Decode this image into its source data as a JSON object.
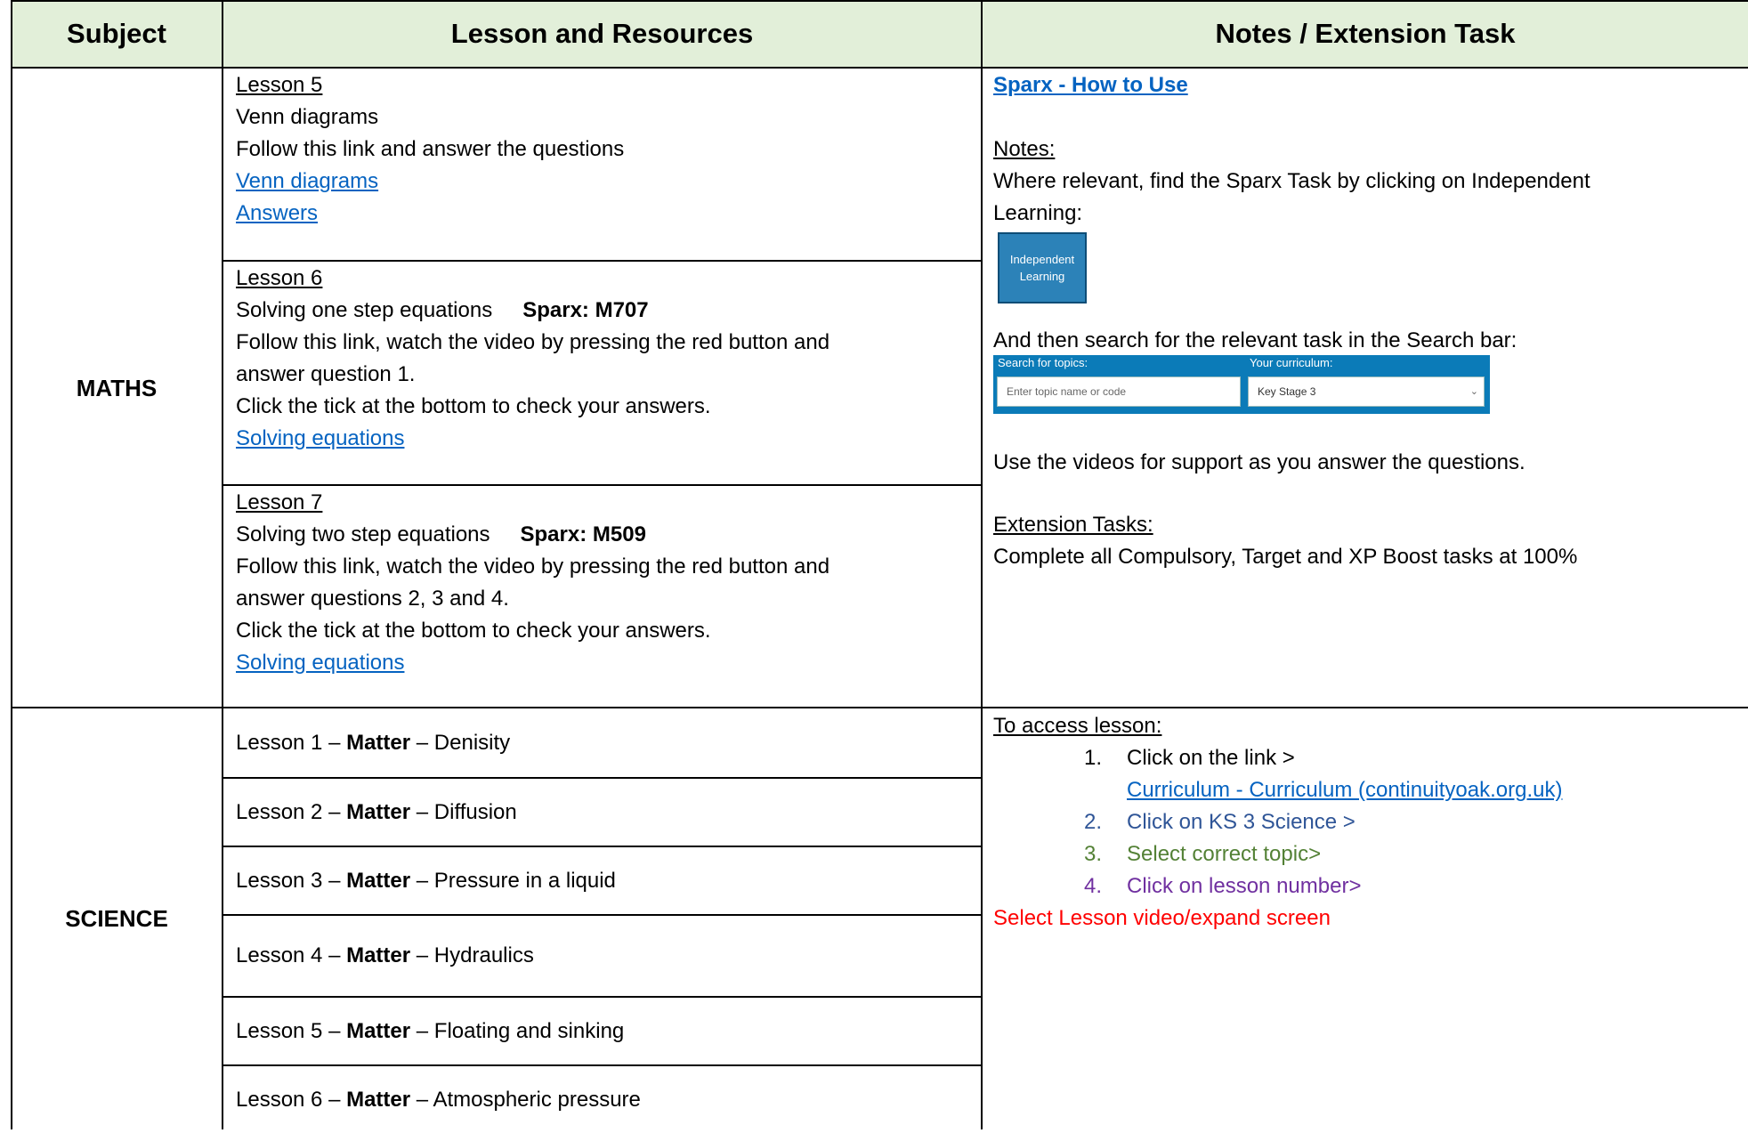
{
  "header": {
    "subject": "Subject",
    "lesson_resources": "Lesson and Resources",
    "notes": "Notes / Extension Task"
  },
  "maths": {
    "subject": "MATHS",
    "lesson5": {
      "title": "Lesson 5",
      "topic": "Venn diagrams",
      "instruction": "Follow this link and answer the questions",
      "link1": "Venn diagrams",
      "link2": "Answers"
    },
    "lesson6": {
      "title": "Lesson 6",
      "topic": "Solving one step equations",
      "sparx": "Sparx: M707",
      "line1": "Follow this link, watch the video by pressing the red button and",
      "line2": "answer question 1.",
      "line3": "Click the tick at the bottom to check your answers.",
      "link": "Solving equations"
    },
    "lesson7": {
      "title": "Lesson 7",
      "topic": "Solving two step equations",
      "sparx": "Sparx: M509",
      "line1": "Follow this link, watch the video by pressing the red button and",
      "line2": "answer questions 2, 3 and 4.",
      "line3": "Click the tick at the bottom to check your answers.",
      "link": "Solving equations"
    },
    "notes": {
      "sparx_link": "Sparx - How to Use",
      "notes_heading": "Notes:",
      "notes_line1": "Where relevant, find the Sparx Task by clicking on Independent",
      "notes_line2": "Learning:",
      "il_button_line1": "Independent",
      "il_button_line2": "Learning",
      "search_text": "And then search for the relevant task in the Search bar:",
      "search_topics_label": "Search for topics:",
      "search_placeholder": "Enter topic name or code",
      "curriculum_label": "Your curriculum:",
      "curriculum_value": "Key Stage 3",
      "videos_text": "Use the videos for support as you answer the questions.",
      "ext_heading": "Extension Tasks:",
      "ext_text": "Complete all Compulsory, Target and XP Boost tasks at 100%"
    }
  },
  "science": {
    "subject": "SCIENCE",
    "lessons": [
      {
        "prefix": "Lesson 1 – ",
        "bold": "Matter",
        "suffix": " – Denisity"
      },
      {
        "prefix": "Lesson 2 – ",
        "bold": "Matter",
        "suffix": " – Diffusion"
      },
      {
        "prefix": "Lesson 3 – ",
        "bold": "Matter",
        "suffix": " – Pressure in a liquid"
      },
      {
        "prefix": "Lesson 4 – ",
        "bold": "Matter",
        "suffix": " – Hydraulics"
      },
      {
        "prefix": "Lesson 5 – ",
        "bold": "Matter",
        "suffix": " – Floating and sinking"
      },
      {
        "prefix": "Lesson 6 – ",
        "bold": "Matter",
        "suffix": " – Atmospheric pressure"
      }
    ],
    "notes": {
      "heading": "To access lesson:",
      "steps": [
        {
          "num": "1.",
          "text": "Click on the link >"
        },
        {
          "num": "",
          "text": "Curriculum - Curriculum (continuityoak.org.uk)"
        },
        {
          "num": "2.",
          "text": "Click on KS 3 Science >"
        },
        {
          "num": "3.",
          "text": "Select correct topic>"
        },
        {
          "num": "4.",
          "text": "Click on lesson number>"
        }
      ],
      "final": "Select Lesson video/expand screen"
    }
  },
  "colors": {
    "header_bg": "#e2efd9",
    "link": "#0563c1",
    "step2": "#2f5597",
    "step3": "#538135",
    "step4": "#7030a0",
    "final": "#ff0000"
  }
}
